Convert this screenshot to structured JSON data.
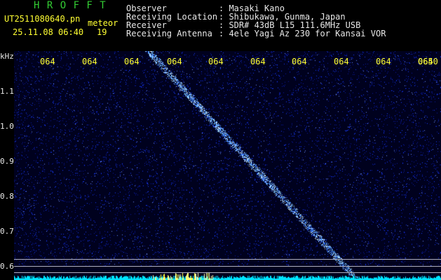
{
  "title": "H R O F F T",
  "filename": "UT2511080640.pn",
  "meteor_label": "meteor",
  "timestamp": "25.11.08 06:40",
  "count": "19",
  "info": {
    "observer_key": "Observer",
    "observer_value": ": Masaki Kano",
    "location_key": "Receiving Location",
    "location_value": ": Shibukawa, Gunma, Japan",
    "receiver_key": "Receiver",
    "receiver_value": ": SDR# 43dB L15 111.6MHz USB",
    "antenna_key": "Receiving Antenna",
    "antenna_value": ": 4ele Yagi Az 230 for Kansai VOR"
  },
  "axis": {
    "unit": "kHz",
    "x_ticks": [
      "064",
      "064",
      "064",
      "064",
      "064",
      "064",
      "064",
      "064",
      "064",
      "064",
      "0650"
    ],
    "y_ticks": [
      "1.1",
      "1.0",
      "0.9",
      "0.8",
      "0.7",
      "0.6"
    ]
  },
  "colors": {
    "background": "#00011e",
    "noise": "#1a3cff",
    "trail": "#9fd8ff",
    "header_green": "#33cc33",
    "header_yellow": "#ffff33"
  }
}
